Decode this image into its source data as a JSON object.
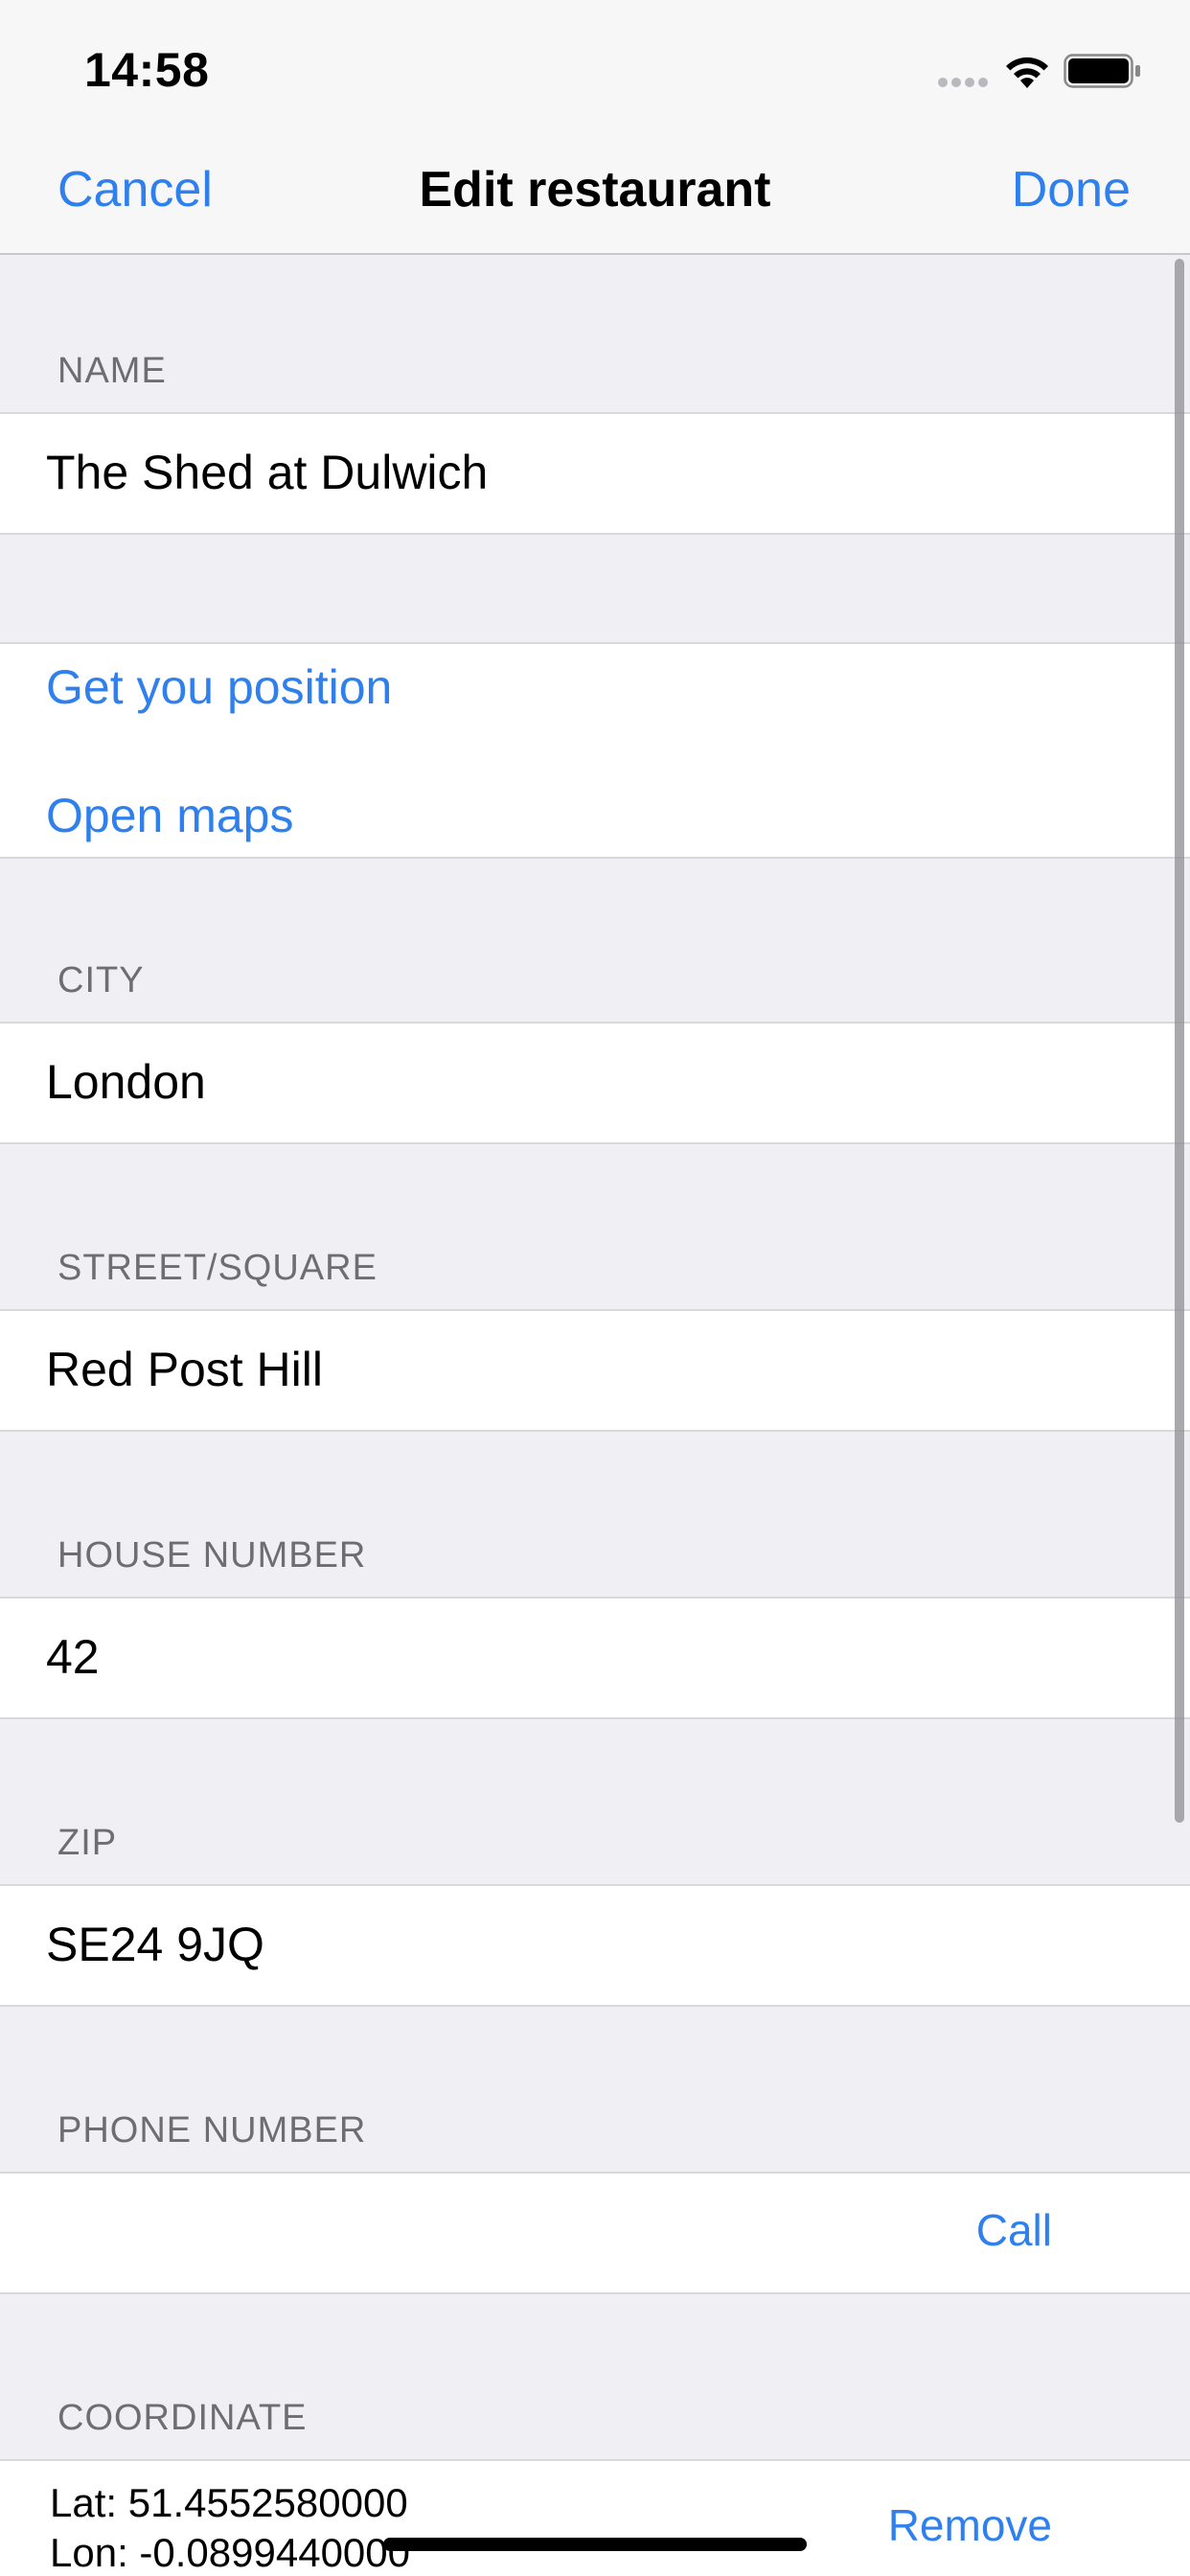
{
  "status_bar": {
    "time": "14:58"
  },
  "nav": {
    "cancel_label": "Cancel",
    "title": "Edit restaurant",
    "done_label": "Done"
  },
  "form": {
    "name_header": "NAME",
    "name_value": "The Shed at Dulwich",
    "get_position_label": "Get you position",
    "open_maps_label": "Open maps",
    "city_header": "CITY",
    "city_value": "London",
    "street_header": "STREET/SQUARE",
    "street_value": "Red Post Hill",
    "house_number_header": "HOUSE NUMBER",
    "house_number_value": "42",
    "zip_header": "ZIP",
    "zip_value": "SE24 9JQ",
    "phone_header": "PHONE NUMBER",
    "phone_value": "",
    "call_label": "Call",
    "coordinate_header": "COORDINATE",
    "lat_text": "Lat: 51.4552580000",
    "lon_text": "Lon: -0.0899440000",
    "remove_label": "Remove"
  },
  "colors": {
    "accent": "#2f80ed",
    "background": "#efeff4",
    "header_text": "#6d6d72"
  }
}
